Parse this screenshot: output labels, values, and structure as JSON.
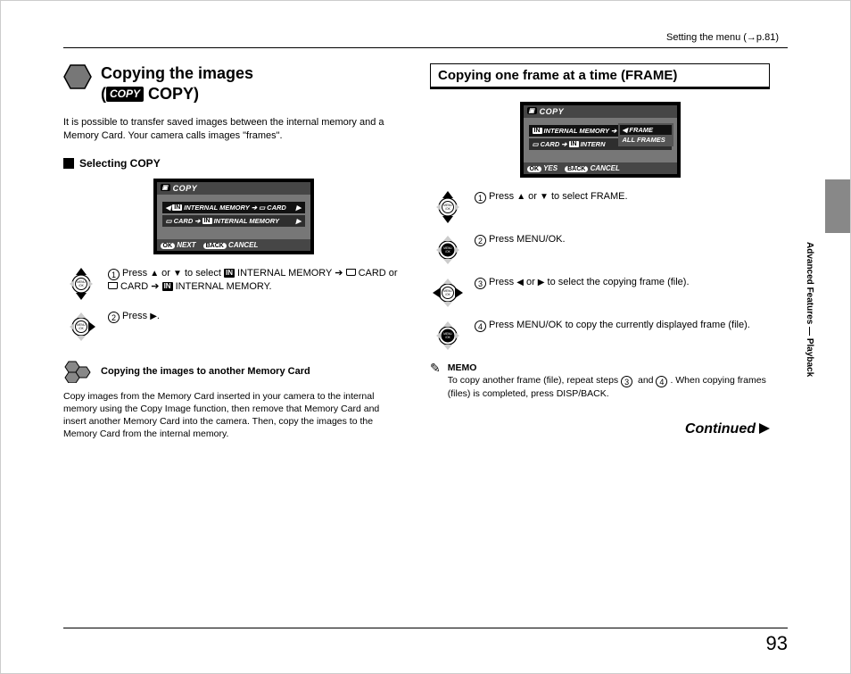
{
  "header": {
    "ref": "Setting the menu (→p.81)"
  },
  "sideTab": "Advanced Features — Playback",
  "left": {
    "h1_a": "Copying the images",
    "h1_b_prefix": "(",
    "h1_b_chip": "COPY",
    "h1_b_word": " COPY)",
    "intro": "It is possible to transfer saved images between the internal memory and a Memory Card. Your camera calls images \"frames\".",
    "subhead": "Selecting COPY",
    "lcd": {
      "title": "COPY",
      "line1_a": "INTERNAL MEMORY",
      "line1_b": "CARD",
      "line2_a": "CARD",
      "line2_b": "INTERNAL MEMORY",
      "foot_ok": "OK",
      "foot_next": "NEXT",
      "foot_back": "BACK",
      "foot_cancel": "CANCEL"
    },
    "step1": {
      "num": "1",
      "pre": "Press ",
      "mid": " or ",
      "post": " to select ",
      "seg_a": " INTERNAL MEMORY ",
      "seg_b": " CARD or ",
      "seg_c": " CARD ",
      "seg_d": " INTERNAL MEMORY."
    },
    "step2": {
      "num": "2",
      "text": "Press "
    },
    "tip_title": "Copying the images to another Memory Card",
    "tip_body": "Copy images from the Memory Card inserted in your camera to the internal memory using the Copy Image function, then remove that Memory Card and insert another Memory Card into the camera. Then, copy the images to the Memory Card from the internal memory."
  },
  "right": {
    "h2": "Copying one frame at a time (FRAME)",
    "lcd": {
      "title": "COPY",
      "line_a": "INTERNAL MEMORY",
      "line_b": "CARD",
      "line_c": "INTERN",
      "opt_frame": "FRAME",
      "opt_all": "ALL FRAMES",
      "foot_ok": "OK",
      "foot_yes": "YES",
      "foot_back": "BACK",
      "foot_cancel": "CANCEL"
    },
    "s1": {
      "num": "1",
      "a": "Press ",
      "b": " or ",
      "c": " to select FRAME."
    },
    "s2": {
      "num": "2",
      "text": "Press MENU/OK."
    },
    "s3": {
      "num": "3",
      "a": "Press ",
      "b": " or ",
      "c": " to select the copying frame (file)."
    },
    "s4": {
      "num": "4",
      "text": "Press MENU/OK to copy the currently displayed frame (file)."
    },
    "memo_label": "MEMO",
    "memo_a": "To copy another frame (file), repeat steps ",
    "memo_n1": "3",
    "memo_mid": " and ",
    "memo_n2": "4",
    "memo_b": ". When copying frames (files) is completed, press DISP/BACK.",
    "continued": "Continued"
  },
  "pageNumber": "93"
}
